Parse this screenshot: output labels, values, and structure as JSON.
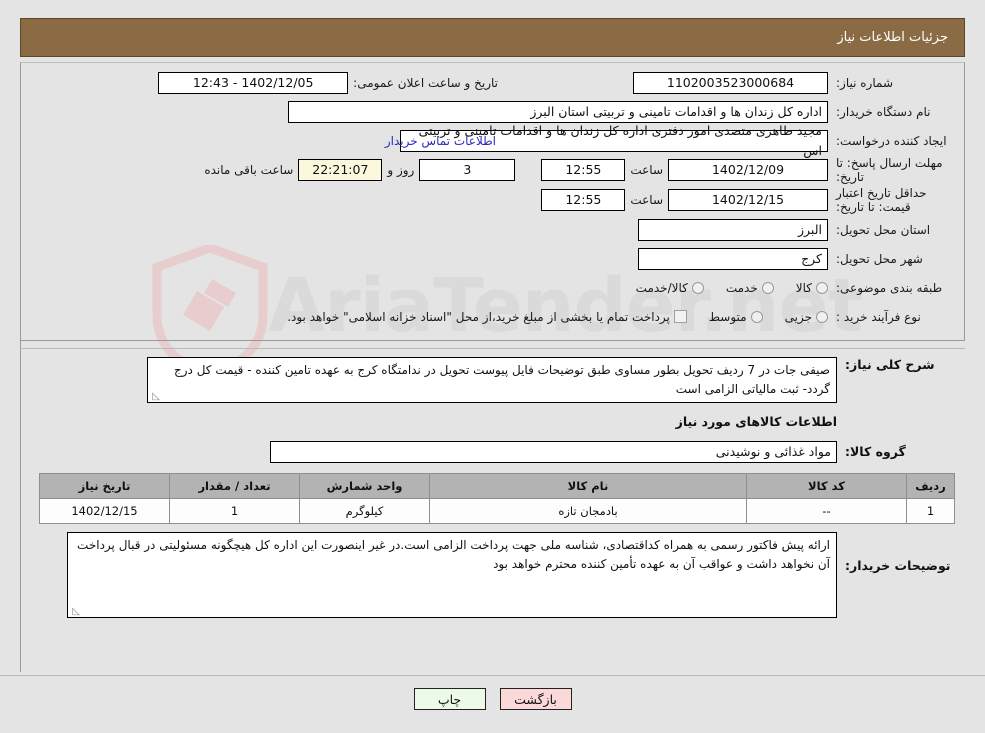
{
  "header": {
    "title": "جزئیات اطلاعات نیاز"
  },
  "form": {
    "need_number": {
      "label": "شماره نیاز:",
      "value": "1102003523000684"
    },
    "public_announce": {
      "label": "تاریخ و ساعت اعلان عمومی:",
      "value": "1402/12/05 - 12:43"
    },
    "buyer_org": {
      "label": "نام دستگاه خریدار:",
      "value": "اداره کل زندان ها و اقدامات تامینی و تربیتی استان البرز"
    },
    "creator": {
      "label": "ایجاد کننده درخواست:",
      "value": "مجید طاهری متصدی امور دفتری اداره کل زندان ها و اقدامات تامینی و تربیتی اس"
    },
    "contact_link": "اطلاعات تماس خریدار",
    "answer_deadline": {
      "label": "مهلت ارسال پاسخ: تا تاریخ:",
      "date": "1402/12/09",
      "time_label": "ساعت",
      "time": "12:55",
      "days": "3",
      "days_label": "روز و",
      "clock": "22:21:07",
      "remaining_label": "ساعت باقی مانده"
    },
    "price_validity": {
      "label": "حداقل تاریخ اعتبار قیمت: تا تاریخ:",
      "date": "1402/12/15",
      "time_label": "ساعت",
      "time": "12:55"
    },
    "delivery_province": {
      "label": "استان محل تحویل:",
      "value": "البرز"
    },
    "delivery_city": {
      "label": "شهر محل تحویل:",
      "value": "کرج"
    },
    "category": {
      "label": "طبقه بندی موضوعی:",
      "options": [
        "کالا",
        "خدمت",
        "کالا/خدمت"
      ],
      "selected": ""
    },
    "purchase_type": {
      "label": "نوع فرآیند خرید :",
      "options": [
        "جزیی",
        "متوسط"
      ],
      "selected": "",
      "checkbox_note": "پرداخت تمام یا بخشی از مبلغ خرید،از محل \"اسناد خزانه اسلامی\" خواهد بود."
    }
  },
  "details": {
    "description_label": "شرح کلی نیاز:",
    "description_value": "صیفی جات در 7 ردیف  تحویل بطور مساوی طبق توضیحات فایل پیوست تحویل در ندامتگاه کرج به عهده تامین کننده -  قیمت کل درج گردد- ثبت مالیاتی الزامی است",
    "goods_info_heading": "اطلاعات کالاهای مورد نیاز",
    "goods_group_label": "گروه کالا:",
    "goods_group_value": "مواد غذائی و نوشیدنی",
    "buyer_notes_label": "توضیحات خریدار:",
    "buyer_notes_value": "ارائه پیش فاکتور رسمی به همراه کداقتصادی، شناسه ملی جهت پرداخت الزامی است.در غیر اینصورت این اداره کل هیچگونه مسئولیتی در قبال پرداخت آن نخواهد داشت و عواقب آن به عهده تأمین کننده محترم خواهد بود"
  },
  "table": {
    "columns": [
      "ردیف",
      "کد کالا",
      "نام کالا",
      "واحد شمارش",
      "تعداد / مقدار",
      "تاریخ نیاز"
    ],
    "rows": [
      {
        "row": "1",
        "code": "--",
        "name": "بادمجان تازه",
        "unit": "کیلوگرم",
        "qty": "1",
        "need_date": "1402/12/15"
      }
    ]
  },
  "buttons": {
    "print": "چاپ",
    "back": "بازگشت"
  },
  "watermark": {
    "text": "AriaTender.net"
  },
  "colors": {
    "header_bg": "#8b6b44",
    "link": "#2b2bbd",
    "btn_print_bg": "#ecfbe8",
    "btn_back_bg": "#fbd9d9",
    "clock_bg": "#fbf8dd",
    "table_header_bg": "#b3b3b3"
  }
}
